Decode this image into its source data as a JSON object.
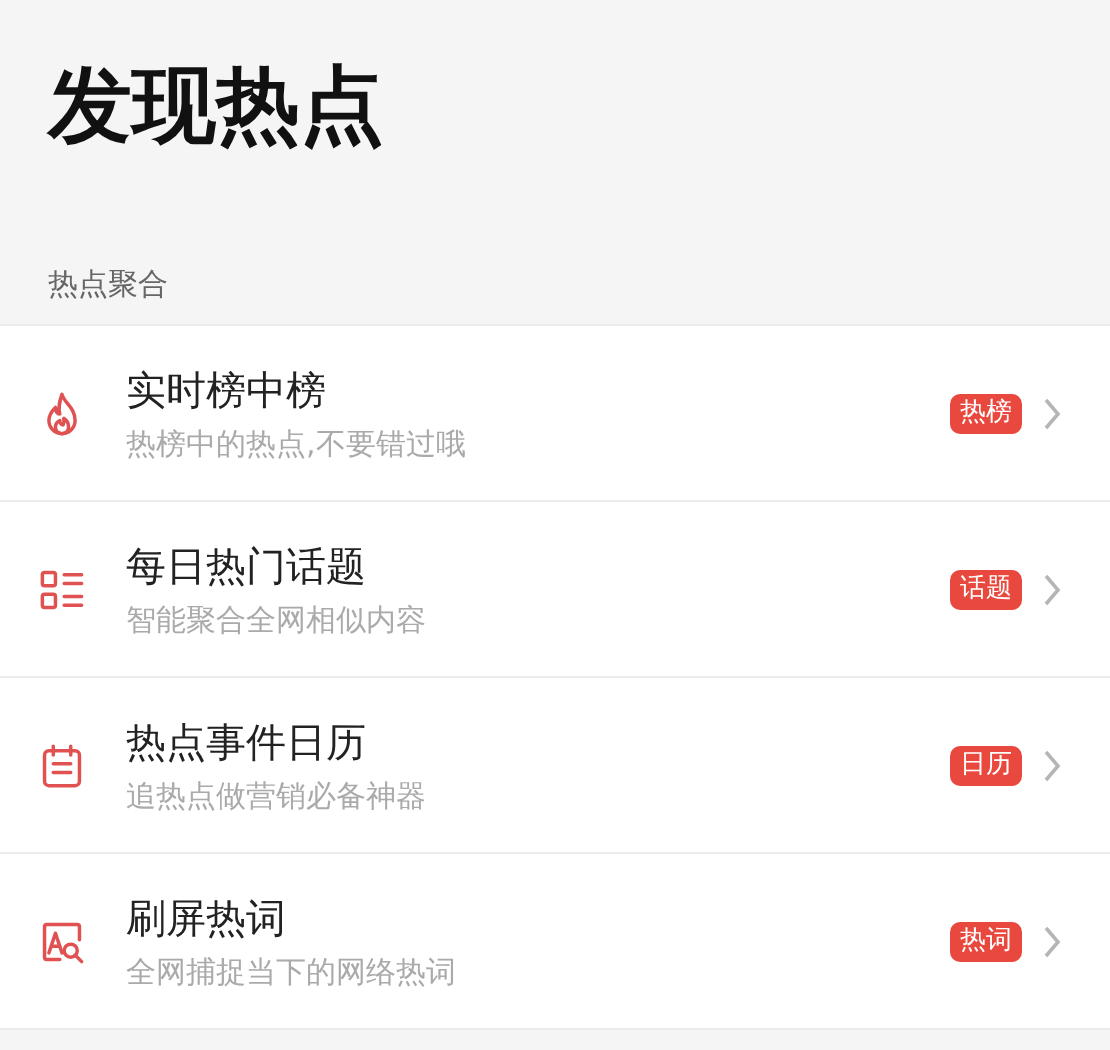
{
  "page": {
    "title": "发现热点"
  },
  "section": {
    "label": "热点聚合"
  },
  "items": [
    {
      "kind": "flame",
      "title": "实时榜中榜",
      "subtitle": "热榜中的热点,不要错过哦",
      "badge": "热榜"
    },
    {
      "kind": "list",
      "title": "每日热门话题",
      "subtitle": "智能聚合全网相似内容",
      "badge": "话题"
    },
    {
      "kind": "calendar",
      "title": "热点事件日历",
      "subtitle": "追热点做营销必备神器",
      "badge": "日历"
    },
    {
      "kind": "search-text",
      "title": "刷屏热词",
      "subtitle": "全网捕捉当下的网络热词",
      "badge": "热词"
    }
  ]
}
